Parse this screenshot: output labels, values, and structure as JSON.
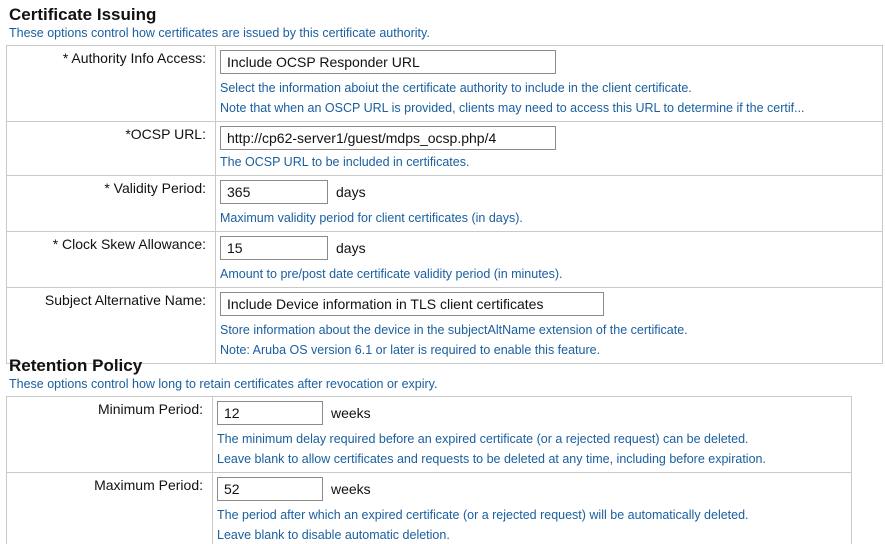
{
  "certificate_issuing": {
    "title": "Certificate Issuing",
    "description": "These options control how certificates are issued by this certificate authority.",
    "authority_info_access": {
      "label": "* Authority Info Access:",
      "value": "Include OCSP Responder URL",
      "help1": "Select the information aboiut the certificate authority to include in the client certificate.",
      "help2": "Note that when an OSCP URL is provided, clients may need to access this URL to determine if the certif..."
    },
    "ocsp_url": {
      "label": "*OCSP URL:",
      "value": "http://cp62-server1/guest/mdps_ocsp.php/4",
      "help1": "The OCSP URL to be included in certificates."
    },
    "validity_period": {
      "label": "* Validity Period:",
      "value": "365",
      "unit": "days",
      "help1": "Maximum validity period for client certificates (in days)."
    },
    "clock_skew": {
      "label": "* Clock Skew Allowance:",
      "value": "15",
      "unit": "days",
      "help1": "Amount to pre/post date certificate validity period (in minutes)."
    },
    "subject_alt_name": {
      "label": "Subject Alternative Name:",
      "value": "Include Device information in TLS client certificates",
      "help1": "Store information about the device in the subjectAltName extension of the certificate.",
      "help2": "Note: Aruba OS version 6.1 or later is required to enable this feature."
    }
  },
  "retention_policy": {
    "title": "Retention Policy",
    "description": "These options control how long to retain certificates after revocation or expiry.",
    "minimum_period": {
      "label": "Minimum Period:",
      "value": "12",
      "unit": "weeks",
      "help1": "The minimum delay required before an expired certificate (or a rejected request) can be deleted.",
      "help2": "Leave blank to allow certificates and requests to be deleted at any time, including before expiration."
    },
    "maximum_period": {
      "label": "Maximum Period:",
      "value": "52",
      "unit": "weeks",
      "help1": "The period after which an expired certificate (or a rejected request) will be automatically deleted.",
      "help2": "Leave blank to disable automatic deletion."
    }
  }
}
